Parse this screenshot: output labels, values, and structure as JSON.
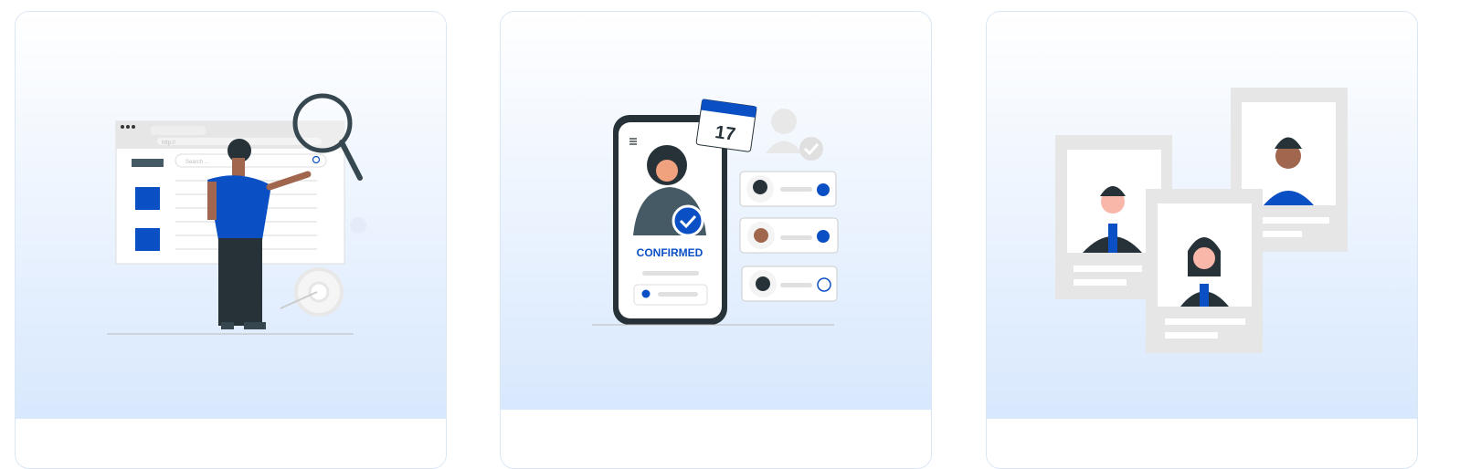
{
  "cards": [
    {
      "name": "search-illustration",
      "url_text": "http://",
      "search_placeholder": "Search ..."
    },
    {
      "name": "booking-confirmed-illustration",
      "calendar_day": "17",
      "status": "CONFIRMED"
    },
    {
      "name": "profiles-illustration"
    }
  ],
  "colors": {
    "accent": "#0a4fc4",
    "gradient_bottom": "#d8e8fd",
    "card_border": "#dbe6f5"
  }
}
